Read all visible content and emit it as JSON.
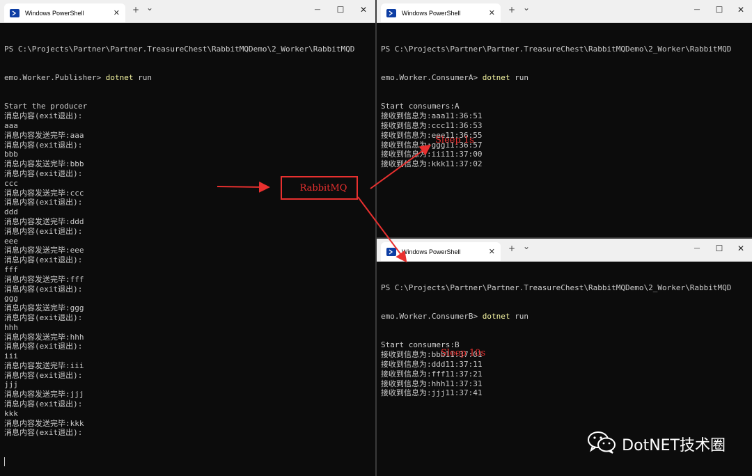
{
  "windows": {
    "publisher": {
      "tab_title": "Windows PowerShell",
      "prompt_line_1": "PS C:\\Projects\\Partner\\Partner.TreasureChest\\RabbitMQDemo\\2_Worker\\RabbitMQD",
      "prompt_line_2_prefix": "emo.Worker.Publisher> ",
      "command_word": "dotnet",
      "command_rest": " run",
      "lines": [
        "Start the producer",
        "消息内容(exit退出):",
        "aaa",
        "消息内容发送完毕:aaa",
        "消息内容(exit退出):",
        "bbb",
        "消息内容发送完毕:bbb",
        "消息内容(exit退出):",
        "ccc",
        "消息内容发送完毕:ccc",
        "消息内容(exit退出):",
        "ddd",
        "消息内容发送完毕:ddd",
        "消息内容(exit退出):",
        "eee",
        "消息内容发送完毕:eee",
        "消息内容(exit退出):",
        "fff",
        "消息内容发送完毕:fff",
        "消息内容(exit退出):",
        "ggg",
        "消息内容发送完毕:ggg",
        "消息内容(exit退出):",
        "hhh",
        "消息内容发送完毕:hhh",
        "消息内容(exit退出):",
        "iii",
        "消息内容发送完毕:iii",
        "消息内容(exit退出):",
        "jjj",
        "消息内容发送完毕:jjj",
        "消息内容(exit退出):",
        "kkk",
        "消息内容发送完毕:kkk",
        "消息内容(exit退出):"
      ]
    },
    "consumer_a": {
      "tab_title": "Windows PowerShell",
      "prompt_line_1": "PS C:\\Projects\\Partner\\Partner.TreasureChest\\RabbitMQDemo\\2_Worker\\RabbitMQD",
      "prompt_line_2_prefix": "emo.Worker.ConsumerA> ",
      "command_word": "dotnet",
      "command_rest": " run",
      "lines": [
        "Start consumers:A",
        "接收到信息为:aaa11:36:51",
        "接收到信息为:ccc11:36:53",
        "接收到信息为:eee11:36:55",
        "接收到信息为:ggg11:36:57",
        "接收到信息为:iii11:37:00",
        "接收到信息为:kkk11:37:02"
      ]
    },
    "consumer_b": {
      "tab_title": "Windows PowerShell",
      "prompt_line_1": "PS C:\\Projects\\Partner\\Partner.TreasureChest\\RabbitMQDemo\\2_Worker\\RabbitMQD",
      "prompt_line_2_prefix": "emo.Worker.ConsumerB> ",
      "command_word": "dotnet",
      "command_rest": " run",
      "lines": [
        "Start consumers:B",
        "接收到信息为:bbb11:37:01",
        "接收到信息为:ddd11:37:11",
        "接收到信息为:fff11:37:21",
        "接收到信息为:hhh11:37:31",
        "接收到信息为:jjj11:37:41"
      ]
    }
  },
  "annotations": {
    "broker_label": "RabbitMQ",
    "sleep_a": "Sleep 1s",
    "sleep_b": "Sleep 10s",
    "color": "#e8302f"
  },
  "watermark": {
    "text": "DotNET技术圈",
    "icon": "wechat-icon"
  },
  "titlebar_glyphs": {
    "close_tab": "✕",
    "new_tab": "+",
    "dropdown": "⌄",
    "minimize": "—",
    "maximize": "☐",
    "close": "✕"
  }
}
